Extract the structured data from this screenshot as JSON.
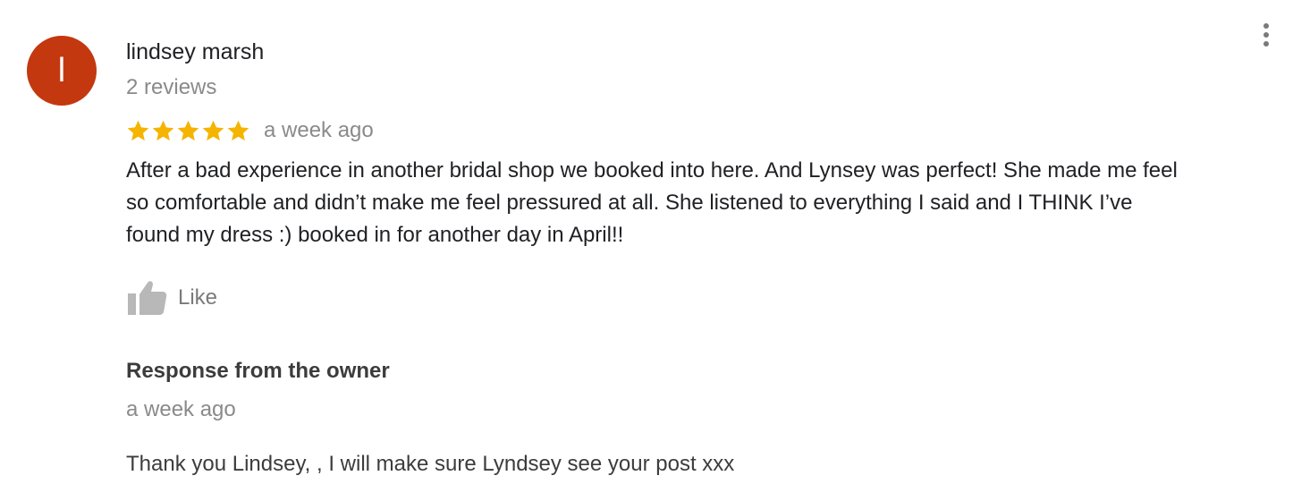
{
  "review": {
    "avatar_letter": "l",
    "avatar_color": "#c4380f",
    "reviewer_name": "lindsey marsh",
    "review_count": "2 reviews",
    "rating": 5,
    "rating_max": 5,
    "star_color": "#f5b400",
    "time_ago": "a week ago",
    "text": "After a bad experience in another bridal shop we booked into here. And Lynsey was perfect! She made me feel so comfortable and didn’t make me feel pressured at all. She listened to everything I said and I THINK I’ve found my dress :) booked in for another day in April!!",
    "like_label": "Like",
    "like_icon": "thumbs-up-icon",
    "more_icon": "more-vert-icon"
  },
  "owner_response": {
    "title": "Response from the owner",
    "time_ago": "a week ago",
    "text": "Thank you Lindsey, , I will make sure Lyndsey see your post xxx"
  }
}
